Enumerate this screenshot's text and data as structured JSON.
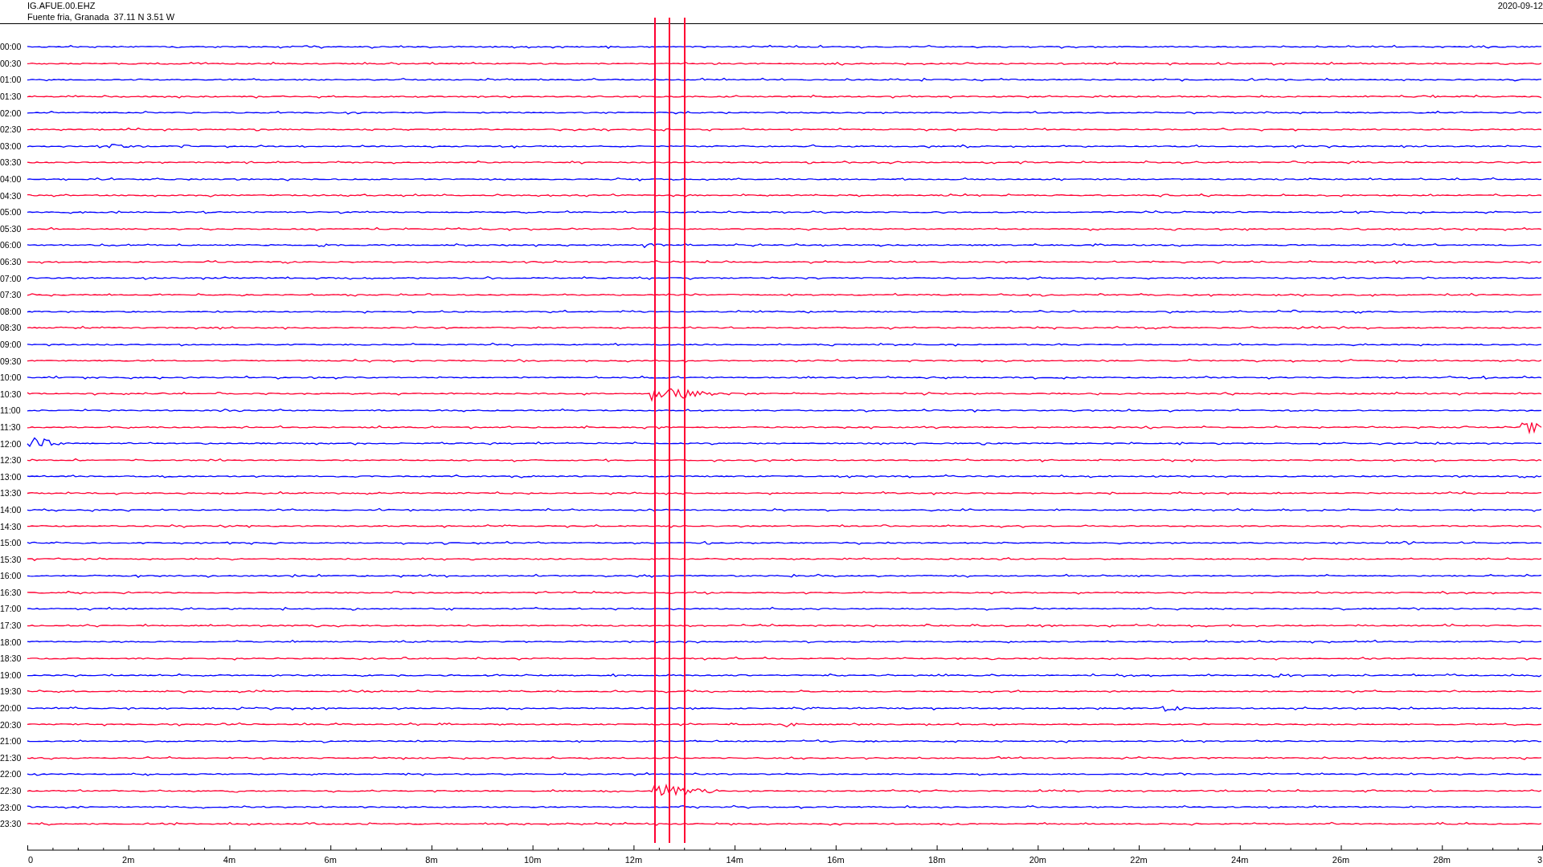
{
  "header": {
    "station": "IG.AFUE.00.EHZ",
    "location": "Fuente fria, Granada  37.11 N 3.51 W",
    "date": "2020-09-12"
  },
  "traces": [
    {
      "label": "00:00",
      "color": "#0000ff"
    },
    {
      "label": "00:30",
      "color": "#ff0033"
    },
    {
      "label": "01:00",
      "color": "#0000ff"
    },
    {
      "label": "01:30",
      "color": "#ff0033"
    },
    {
      "label": "02:00",
      "color": "#0000ff"
    },
    {
      "label": "02:30",
      "color": "#ff0033"
    },
    {
      "label": "03:00",
      "color": "#0000ff"
    },
    {
      "label": "03:30",
      "color": "#ff0033"
    },
    {
      "label": "04:00",
      "color": "#0000ff"
    },
    {
      "label": "04:30",
      "color": "#ff0033"
    },
    {
      "label": "05:00",
      "color": "#0000ff"
    },
    {
      "label": "05:30",
      "color": "#ff0033"
    },
    {
      "label": "06:00",
      "color": "#0000ff"
    },
    {
      "label": "06:30",
      "color": "#ff0033"
    },
    {
      "label": "07:00",
      "color": "#0000ff"
    },
    {
      "label": "07:30",
      "color": "#ff0033"
    },
    {
      "label": "08:00",
      "color": "#0000ff"
    },
    {
      "label": "08:30",
      "color": "#ff0033"
    },
    {
      "label": "09:00",
      "color": "#0000ff"
    },
    {
      "label": "09:30",
      "color": "#ff0033"
    },
    {
      "label": "10:00",
      "color": "#0000ff"
    },
    {
      "label": "10:30",
      "color": "#ff0033"
    },
    {
      "label": "11:00",
      "color": "#0000ff"
    },
    {
      "label": "11:30",
      "color": "#ff0033"
    },
    {
      "label": "12:00",
      "color": "#0000ff"
    },
    {
      "label": "12:30",
      "color": "#ff0033"
    },
    {
      "label": "13:00",
      "color": "#0000ff"
    },
    {
      "label": "13:30",
      "color": "#ff0033"
    },
    {
      "label": "14:00",
      "color": "#0000ff"
    },
    {
      "label": "14:30",
      "color": "#ff0033"
    },
    {
      "label": "15:00",
      "color": "#0000ff"
    },
    {
      "label": "15:30",
      "color": "#ff0033"
    },
    {
      "label": "16:00",
      "color": "#0000ff"
    },
    {
      "label": "16:30",
      "color": "#ff0033"
    },
    {
      "label": "17:00",
      "color": "#0000ff"
    },
    {
      "label": "17:30",
      "color": "#ff0033"
    },
    {
      "label": "18:00",
      "color": "#0000ff"
    },
    {
      "label": "18:30",
      "color": "#ff0033"
    },
    {
      "label": "19:00",
      "color": "#0000ff"
    },
    {
      "label": "19:30",
      "color": "#ff0033"
    },
    {
      "label": "20:00",
      "color": "#0000ff"
    },
    {
      "label": "20:30",
      "color": "#ff0033"
    },
    {
      "label": "21:00",
      "color": "#0000ff"
    },
    {
      "label": "21:30",
      "color": "#ff0033"
    },
    {
      "label": "22:00",
      "color": "#0000ff"
    },
    {
      "label": "22:30",
      "color": "#ff0033"
    },
    {
      "label": "23:00",
      "color": "#0000ff"
    },
    {
      "label": "23:30",
      "color": "#ff0033"
    }
  ],
  "axis": {
    "labels": [
      "0",
      "2m",
      "4m",
      "6m",
      "8m",
      "10m",
      "12m",
      "14m",
      "16m",
      "18m",
      "20m",
      "22m",
      "24m",
      "26m",
      "28m",
      "3"
    ]
  }
}
